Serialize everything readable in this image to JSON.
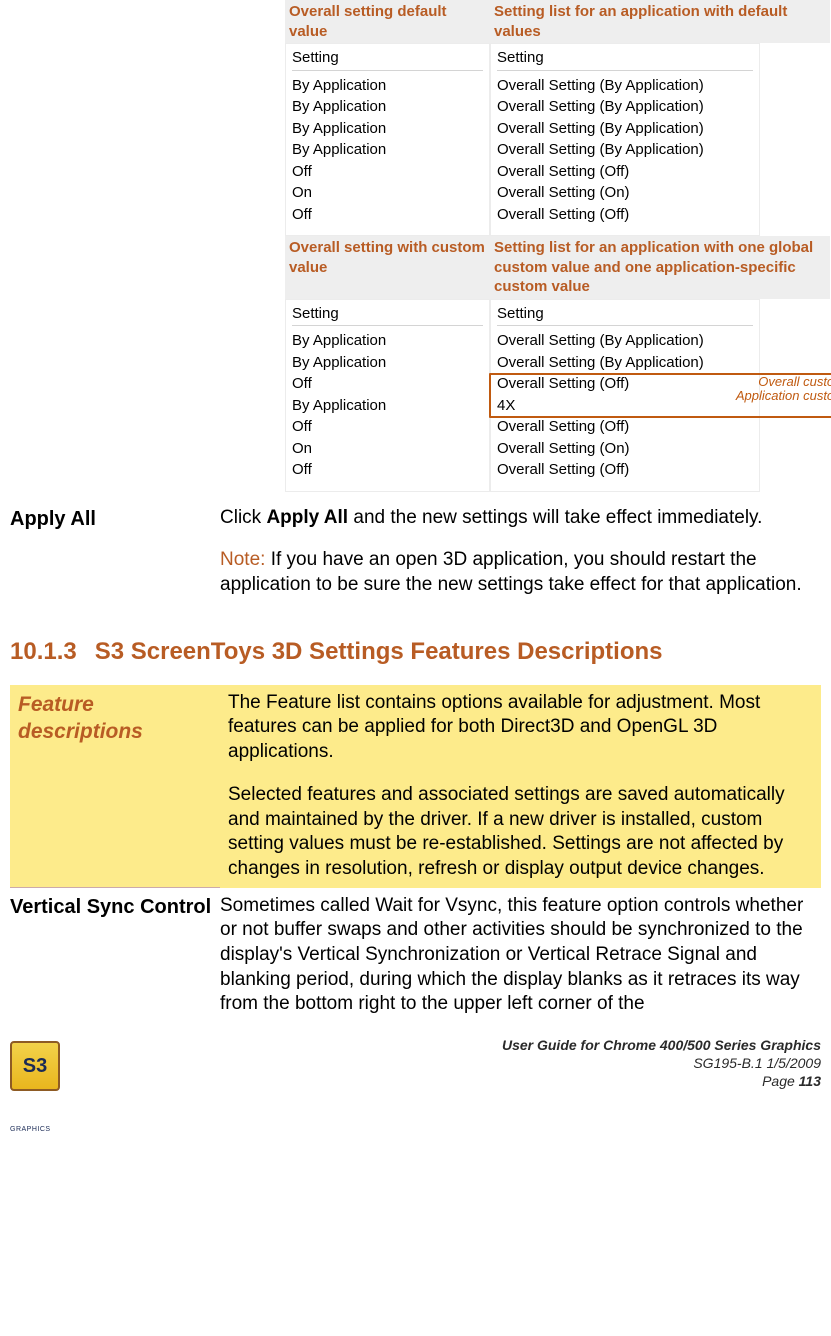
{
  "compare": {
    "header_left_1": "Overall setting default value",
    "header_right_1": "Setting list for an application with default values",
    "panel_title": "Setting",
    "panel1_left": [
      "By Application",
      "By Application",
      "By Application",
      "By Application",
      "Off",
      "On",
      "Off"
    ],
    "panel1_right": [
      "Overall Setting (By Application)",
      "Overall Setting (By Application)",
      "Overall Setting (By Application)",
      "Overall Setting (By Application)",
      "Overall Setting (Off)",
      "Overall Setting (On)",
      "Overall Setting (Off)"
    ],
    "header_left_2": "Overall setting with custom value",
    "header_right_2": "Setting list for an application with one global custom value and one application-specific custom value",
    "panel2_left": [
      "By Application",
      "By Application",
      "Off",
      "By Application",
      "Off",
      "On",
      "Off"
    ],
    "panel2_right": [
      "Overall Setting (By Application)",
      "Overall Setting (By Application)",
      "Overall Setting (Off)",
      "4X",
      "Overall Setting (Off)",
      "Overall Setting (On)",
      "Overall Setting (Off)"
    ],
    "annot_overall": "Overall custom",
    "annot_app": "Application custom"
  },
  "apply": {
    "label": "Apply All",
    "body_pre": "Click ",
    "body_bold": "Apply All",
    "body_post": " and the new settings will take effect immediately.",
    "note_word": "Note:",
    "note_rest": " If you have an open 3D application, you should restart the application to be sure the new settings take effect for that application."
  },
  "section": {
    "number": "10.1.3",
    "title": "S3 ScreenToys 3D Settings Features Descriptions"
  },
  "feature": {
    "left": "Feature descriptions",
    "right_p1": "The Feature list contains options available for adjustment. Most features can be applied for both Direct3D and OpenGL 3D applications.",
    "right_p2": "Selected features and associated settings are saved automatically and maintained by the driver. If a new driver is installed, custom setting values must be re-established. Settings are not affected by changes in resolution, refresh or display output device changes."
  },
  "vsync": {
    "left": "Vertical Sync Control",
    "right": "Sometimes called Wait for Vsync, this feature option controls whether or not buffer swaps and other activities should be synchronized to the display's Vertical Synchronization or Vertical Retrace Signal and blanking period, during which the display blanks as it retraces its way from the bottom right to the upper left corner of the"
  },
  "footer": {
    "logo": "S3",
    "logo_sub": "GRAPHICS",
    "title": "User Guide for Chrome 400/500 Series Graphics",
    "meta": "SG195-B.1   1/5/2009",
    "page_label": "Page ",
    "page_num": "113"
  }
}
